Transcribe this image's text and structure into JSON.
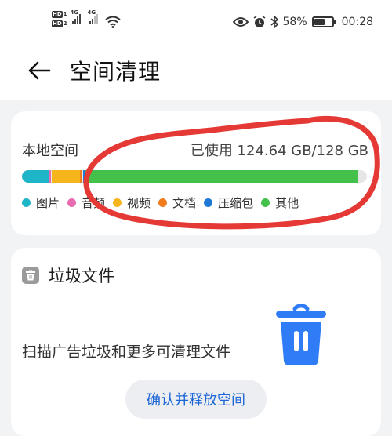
{
  "status_bar": {
    "sim1_badge": "HD",
    "sim1_num": "1",
    "sim2_badge": "HD",
    "sim2_num": "2",
    "net1": "4G",
    "net2": "4G",
    "battery_percent": "58%",
    "battery_level": 0.58,
    "time": "00:28",
    "icons": [
      "eye-icon",
      "alarm-icon",
      "bluetooth-icon",
      "wifi-icon",
      "battery-icon"
    ]
  },
  "header": {
    "title": "空间清理",
    "back_icon": "arrow-left-icon"
  },
  "storage": {
    "label": "本地空间",
    "used_text": "已使用 124.64 GB/128 GB",
    "used_gb": 124.64,
    "total_gb": 128,
    "legend": [
      {
        "label": "图片",
        "color": "#1fb5c9"
      },
      {
        "label": "音频",
        "color": "#e86cb2"
      },
      {
        "label": "视频",
        "color": "#f5b51b"
      },
      {
        "label": "文档",
        "color": "#f07c1e"
      },
      {
        "label": "压缩包",
        "color": "#1f78d6"
      },
      {
        "label": "其他",
        "color": "#43c14b"
      }
    ],
    "annotation_color": "#e53935"
  },
  "junk": {
    "title": "垃圾文件",
    "description": "扫描广告垃圾和更多可清理文件",
    "button_label": "确认并释放空间",
    "icon_color": "#2f7cf6"
  }
}
